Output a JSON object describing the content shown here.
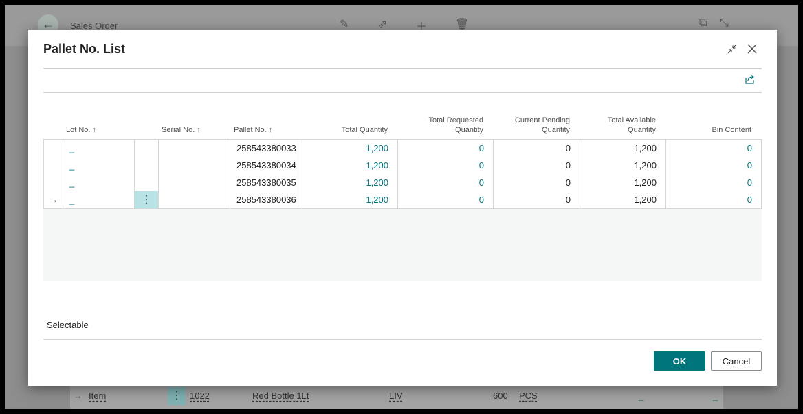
{
  "background": {
    "page_title": "Sales Order",
    "line": {
      "type": "Item",
      "no": "1022",
      "description": "Red Bottle 1Lt",
      "location": "LIV",
      "quantity": "600",
      "uom": "PCS",
      "blank1": "_",
      "blank2": "_"
    }
  },
  "dialog": {
    "title": "Pallet No. List",
    "columns": {
      "lot_no": "Lot No.",
      "serial_no": "Serial No.",
      "pallet_no": "Pallet No.",
      "total_quantity": "Total Quantity",
      "total_requested_1": "Total Requested",
      "total_requested_2": "Quantity",
      "current_pending_1": "Current Pending",
      "current_pending_2": "Quantity",
      "total_available_1": "Total Available",
      "total_available_2": "Quantity",
      "bin_content": "Bin Content"
    },
    "sort_arrow": "↑",
    "rows": [
      {
        "lot": "_",
        "serial": "",
        "pallet": "258543380033",
        "total_qty": "1,200",
        "requested": "0",
        "pending": "0",
        "available": "1,200",
        "bin": "0"
      },
      {
        "lot": "_",
        "serial": "",
        "pallet": "258543380034",
        "total_qty": "1,200",
        "requested": "0",
        "pending": "0",
        "available": "1,200",
        "bin": "0"
      },
      {
        "lot": "_",
        "serial": "",
        "pallet": "258543380035",
        "total_qty": "1,200",
        "requested": "0",
        "pending": "0",
        "available": "1,200",
        "bin": "0"
      },
      {
        "lot": "_",
        "serial": "",
        "pallet": "258543380036",
        "total_qty": "1,200",
        "requested": "0",
        "pending": "0",
        "available": "1,200",
        "bin": "0"
      }
    ],
    "row_menu_glyph": "⋮",
    "current_row_glyph": "→",
    "footer_label": "Selectable",
    "ok_label": "OK",
    "cancel_label": "Cancel"
  },
  "colors": {
    "accent": "#00757c",
    "selected_cell": "#b9e2e4"
  }
}
